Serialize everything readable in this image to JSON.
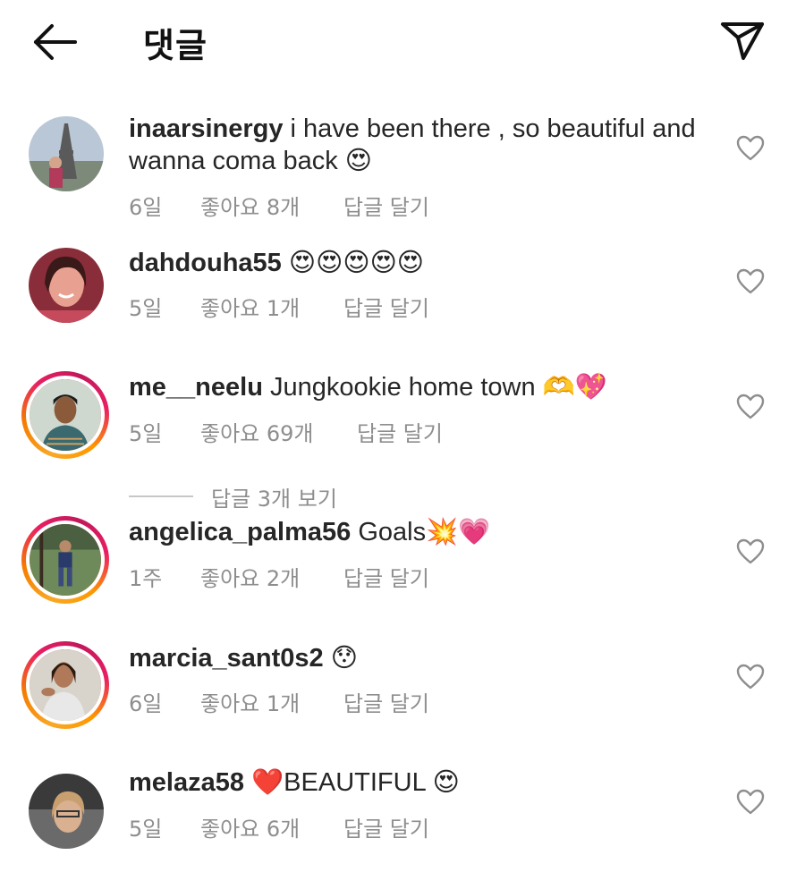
{
  "header": {
    "title": "댓글",
    "back_icon": "arrow-left-icon",
    "send_icon": "paper-plane-icon"
  },
  "comments": [
    {
      "username": "inaarsinergy",
      "text": "i have been there , so beautiful and wanna coma back 😍",
      "time": "6일",
      "likes": "좋아요 8개",
      "reply": "답글 달기"
    },
    {
      "username": "dahdouha55",
      "text": "😍😍😍😍😍",
      "time": "5일",
      "likes": "좋아요 1개",
      "reply": "답글 달기"
    },
    {
      "username": "me__neelu",
      "text": "Jungkookie home town 🫶💖",
      "time": "5일",
      "likes": "좋아요 69개",
      "reply": "답글 달기"
    },
    {
      "username": "angelica_palma56",
      "text": "Goals💥💗",
      "time": "1주",
      "likes": "좋아요 2개",
      "reply": "답글 달기"
    },
    {
      "username": "marcia_sant0s2",
      "text": "😯",
      "time": "6일",
      "likes": "좋아요 1개",
      "reply": "답글 달기"
    },
    {
      "username": "melaza58",
      "text": "❤️BEAUTIFUL 😍",
      "time": "5일",
      "likes": "좋아요 6개",
      "reply": "답글 달기"
    }
  ],
  "view_replies": {
    "label": "답글 3개 보기"
  },
  "colors": {
    "text": "#262626",
    "meta": "#8e8e8e",
    "story_ring_start": "#f9a825",
    "story_ring_end": "#e91e63"
  }
}
